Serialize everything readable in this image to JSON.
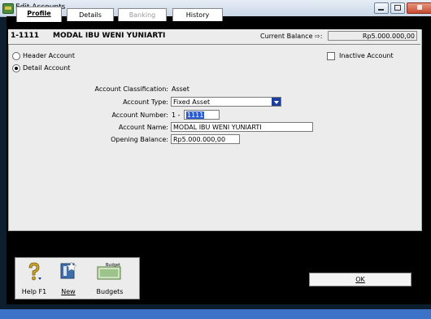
{
  "window": {
    "title": "Edit Accounts"
  },
  "tabs": [
    {
      "label": "Profile",
      "active": true
    },
    {
      "label": "Details",
      "active": false
    },
    {
      "label": "Banking",
      "disabled": true
    },
    {
      "label": "History",
      "active": false
    }
  ],
  "account": {
    "number": "1-1111",
    "name": "MODAL IBU WENI YUNIARTI",
    "current_balance_label": "Current Balance ⇨:",
    "current_balance": "Rp5.000.000,00"
  },
  "options": {
    "header_account": "Header Account",
    "detail_account": "Detail Account",
    "inactive_account": "Inactive Account"
  },
  "form": {
    "classification_label": "Account Classification:",
    "classification_value": "Asset",
    "type_label": "Account Type:",
    "type_value": "Fixed Asset",
    "number_label": "Account Number:",
    "number_prefix": "1 -",
    "number_value": "1111",
    "name_label": "Account Name:",
    "name_value": "MODAL IBU WENI YUNIARTI",
    "opening_label": "Opening Balance:",
    "opening_value": "Rp5.000.000,00"
  },
  "toolbar": {
    "help": "Help F1",
    "new": "New",
    "budgets": "Budgets",
    "budgets_icon_text": "Budget"
  },
  "ok_label": "OK",
  "colors": {
    "titlebar": "#d3dfee",
    "accent_blue": "#2a5bd7",
    "close": "#c44a2e"
  }
}
